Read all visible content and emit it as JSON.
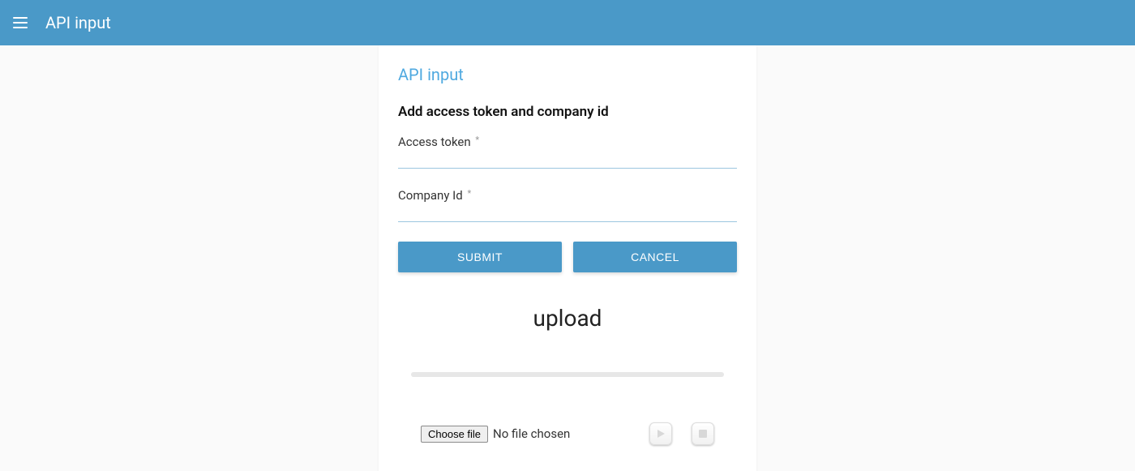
{
  "header": {
    "title": "API input"
  },
  "card": {
    "title": "API input",
    "section_heading": "Add access token and company id",
    "fields": {
      "access_token": {
        "label": "Access token",
        "required_marker": "*",
        "value": ""
      },
      "company_id": {
        "label": "Company Id",
        "required_marker": "*",
        "value": ""
      }
    },
    "buttons": {
      "submit": "SUBMIT",
      "cancel": "CANCEL"
    },
    "upload": {
      "heading": "upload",
      "choose_file_label": "Choose file",
      "file_status": "No file chosen"
    }
  }
}
